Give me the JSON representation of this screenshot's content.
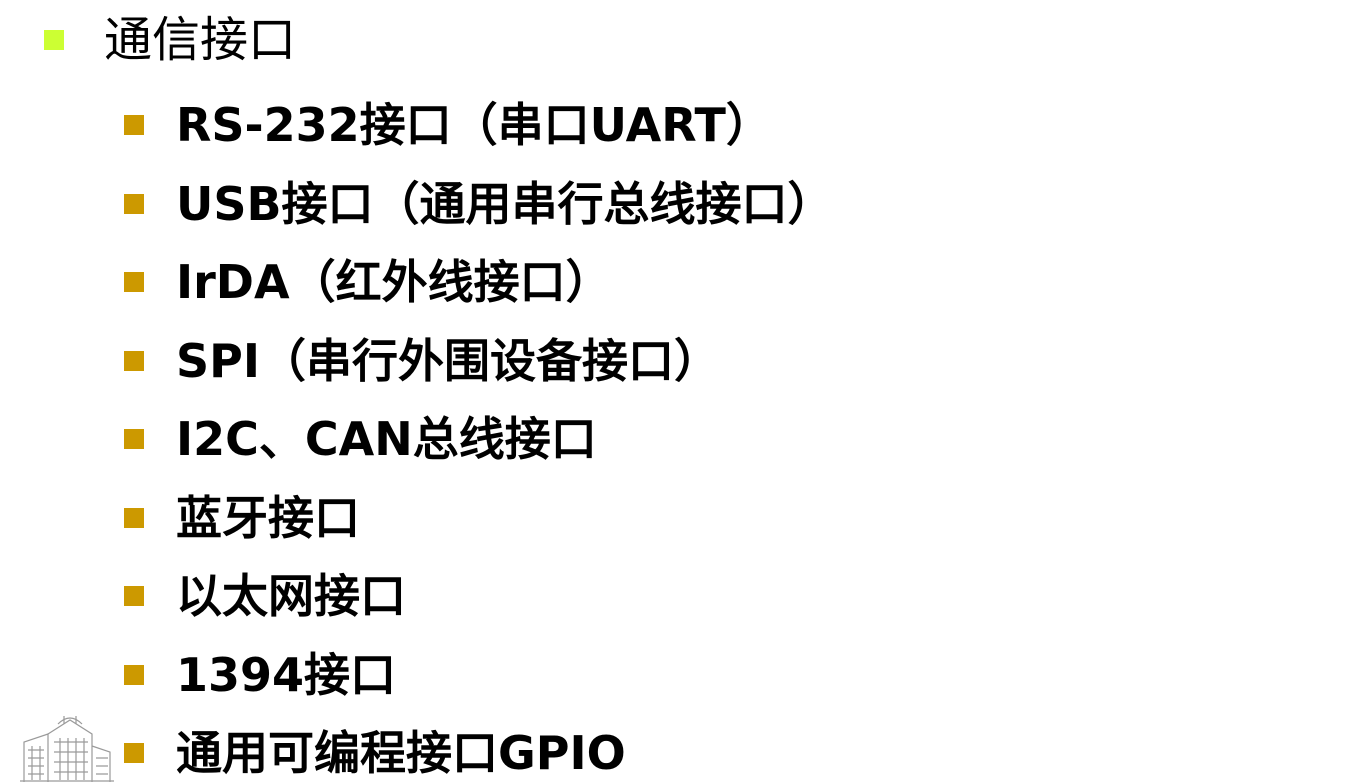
{
  "heading": "通信接口",
  "items": [
    "RS-232接口（串口UART）",
    "USB接口（通用串行总线接口）",
    "IrDA（红外线接口）",
    "SPI（串行外围设备接口）",
    "I2C、CAN总线接口",
    "蓝牙接口",
    "以太网接口",
    "1394接口",
    "通用可编程接口GPIO"
  ],
  "colors": {
    "level1_bullet": "#ccff33",
    "level2_bullet": "#cc9900",
    "text": "#000000",
    "background": "#ffffff"
  },
  "icons": {
    "decoration": "building-sketch-icon"
  }
}
